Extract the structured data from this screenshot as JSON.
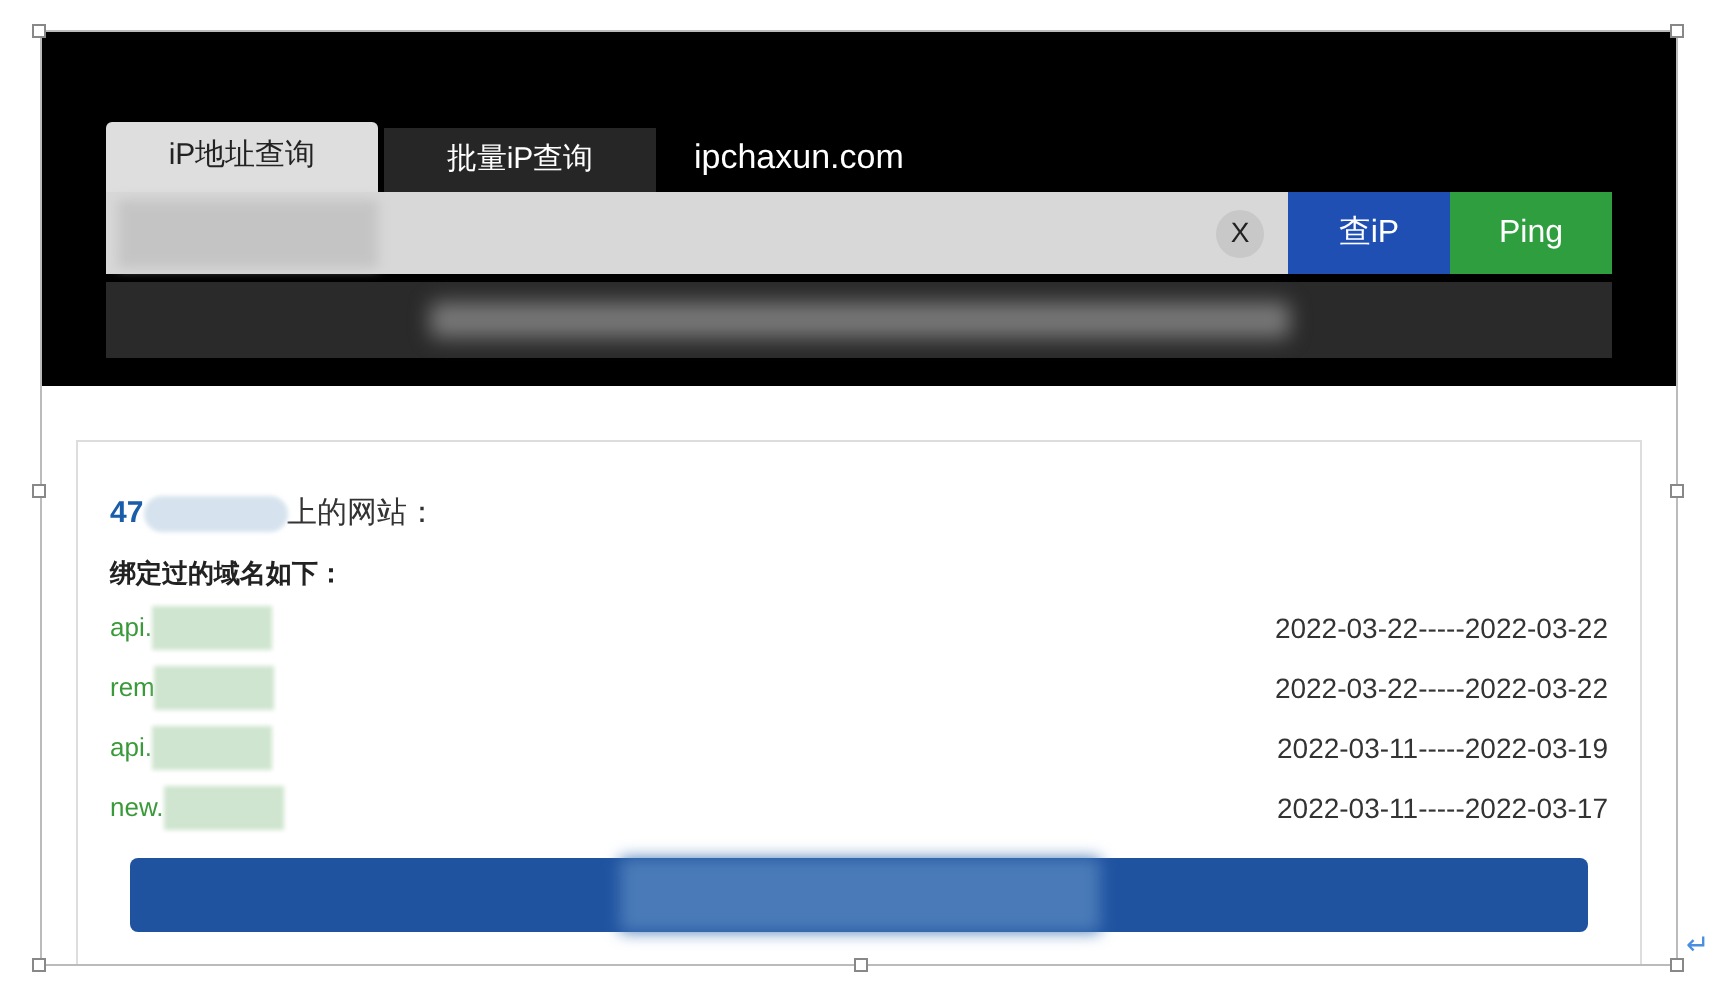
{
  "tabs": [
    {
      "label": "iP地址查询",
      "selected": true
    },
    {
      "label": "批量iP查询",
      "selected": false
    }
  ],
  "site": "ipchaxun.com",
  "search": {
    "clear": "X",
    "buttons": [
      {
        "label": "查iP",
        "kind": "query"
      },
      {
        "label": "Ping",
        "kind": "ping"
      }
    ]
  },
  "result": {
    "heading_prefix": "47",
    "heading_suffix": "上的网站：",
    "subheading": "绑定过的域名如下：",
    "rows": [
      {
        "domain": "api.",
        "dates": "2022-03-22-----2022-03-22"
      },
      {
        "domain": "rem",
        "dates": "2022-03-22-----2022-03-22"
      },
      {
        "domain": "api.",
        "dates": "2022-03-11-----2022-03-19"
      },
      {
        "domain": "new.",
        "dates": "2022-03-11-----2022-03-17"
      }
    ]
  },
  "paragraph_mark": "↵"
}
